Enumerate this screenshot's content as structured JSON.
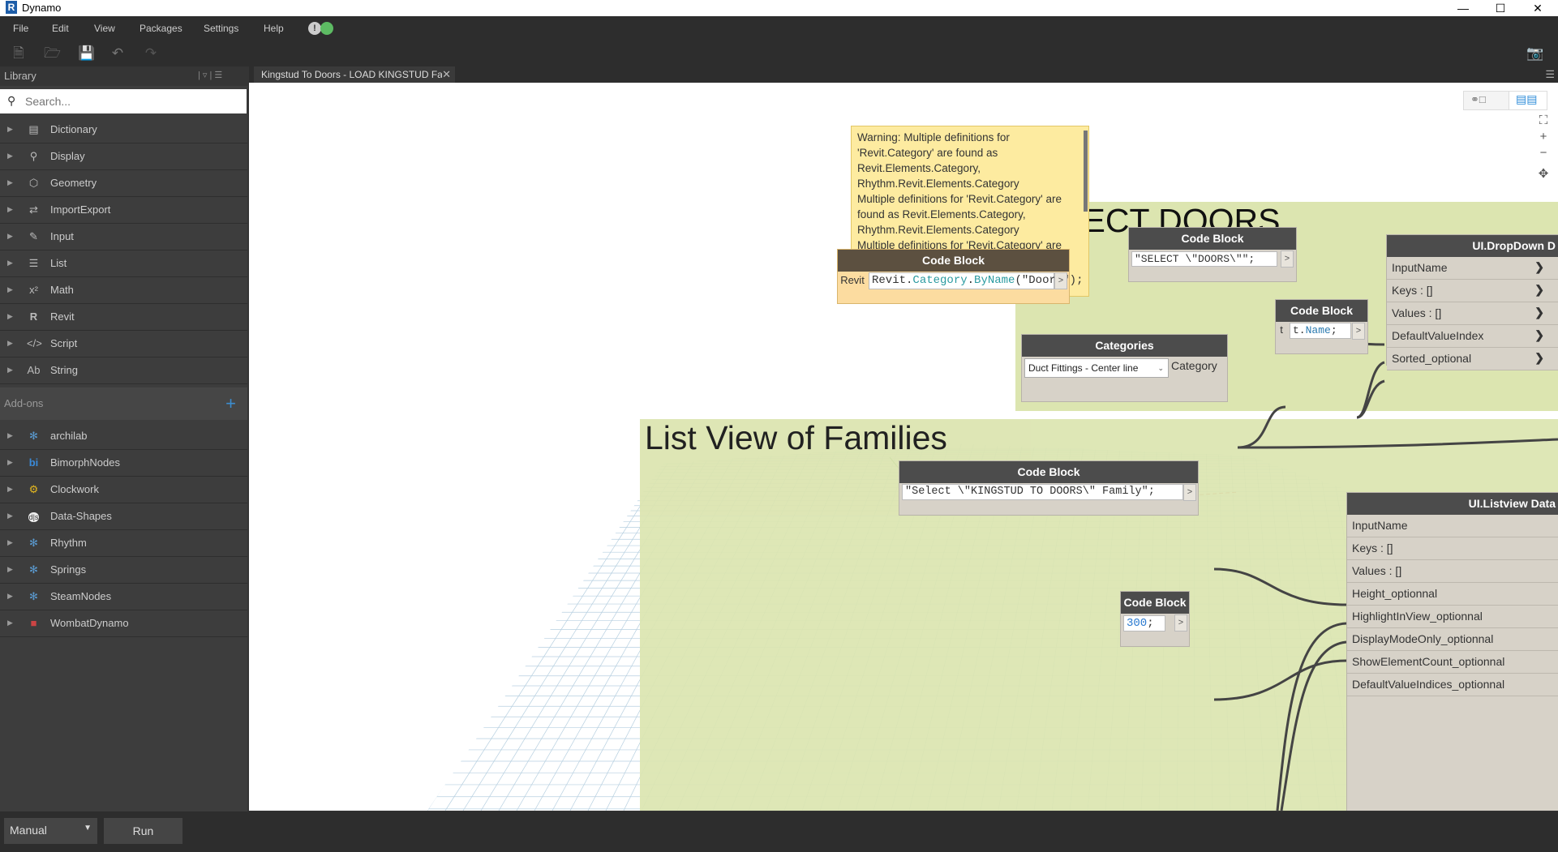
{
  "window": {
    "title": "Dynamo",
    "app_icon": "R"
  },
  "menu": {
    "file": "File",
    "edit": "Edit",
    "view": "View",
    "packages": "Packages",
    "settings": "Settings",
    "help": "Help"
  },
  "library": {
    "title": "Library",
    "search_placeholder": "Search...",
    "categories": [
      "Dictionary",
      "Display",
      "Geometry",
      "ImportExport",
      "Input",
      "List",
      "Math",
      "Revit",
      "Script",
      "String"
    ],
    "addons_title": "Add-ons",
    "addons": [
      "archilab",
      "BimorphNodes",
      "Clockwork",
      "Data-Shapes",
      "Rhythm",
      "Springs",
      "SteamNodes",
      "WombatDynamo"
    ]
  },
  "tab": {
    "label": "Kingstud To Doors - LOAD KINGSTUD Fa"
  },
  "warning": {
    "text": "Warning: Multiple definitions for 'Revit.Category' are found as Revit.Elements.Category, Rhythm.Revit.Elements.Category\nMultiple definitions for 'Revit.Category' are found as Revit.Elements.Category, Rhythm.Revit.Elements.Category\nMultiple definitions for 'Revit.Category' are found as Revit.Elements.Category, Rhythm.Revit.Elements.Category\nMultiple definitions for 'Revit.Category' are"
  },
  "groups": {
    "select_doors": "SELECT DOORS",
    "list_view": "List View of Families"
  },
  "nodes": {
    "code_block_revit": {
      "title": "Code Block",
      "input": "Revit",
      "code_prefix": "Revit.",
      "code_mid": "Category",
      "code_dot": ".",
      "code_fn": "ByName",
      "code_suffix": "(\"Doors\");",
      "out": ">"
    },
    "code_block_select_doors": {
      "title": "Code Block",
      "code": "\"SELECT \\\"DOORS\\\"\";",
      "out": ">"
    },
    "code_block_tname": {
      "title": "Code Block",
      "input": "t",
      "code_t": "t.",
      "code_name": "Name",
      "code_end": ";",
      "out": ">"
    },
    "categories": {
      "title": "Categories",
      "selected": "Duct Fittings - Center line",
      "output": "Category"
    },
    "ui_dropdown": {
      "title": "UI.DropDown D",
      "inputs": [
        "InputName",
        "Keys : []",
        "Values : []",
        "DefaultValueIndex",
        "Sorted_optional"
      ]
    },
    "code_block_kingstud": {
      "title": "Code Block",
      "code": "\"Select \\\"KINGSTUD TO DOORS\\\" Family\";",
      "out": ">"
    },
    "code_block_300": {
      "title": "Code Block",
      "code": "300",
      "code_end": ";",
      "out": ">"
    },
    "ui_listview": {
      "title": "UI.Listview Data",
      "inputs": [
        "InputName",
        "Keys : []",
        "Values : []",
        "Height_optionnal",
        "HighlightInView_optionnal",
        "DisplayModeOnly_optionnal",
        "ShowElementCount_optionnal",
        "DefaultValueIndices_optionnal"
      ]
    }
  },
  "bottom": {
    "run_mode": "Manual",
    "run_button": "Run"
  }
}
